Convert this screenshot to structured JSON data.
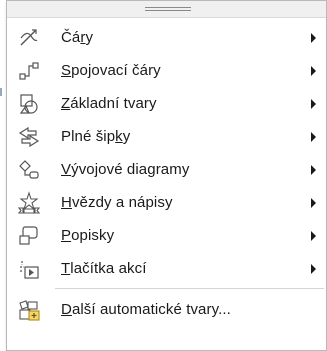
{
  "menu": {
    "items": [
      {
        "pre": "Čá",
        "key": "r",
        "post": "y",
        "icon": "lines-icon",
        "submenu": true
      },
      {
        "pre": "",
        "key": "S",
        "post": "pojovací čáry",
        "icon": "connectors-icon",
        "submenu": true
      },
      {
        "pre": "",
        "key": "Z",
        "post": "ákladní tvary",
        "icon": "basic-shapes-icon",
        "submenu": true
      },
      {
        "pre": "Plné šip",
        "key": "k",
        "post": "y",
        "icon": "block-arrows-icon",
        "submenu": true
      },
      {
        "pre": "",
        "key": "V",
        "post": "ývojové diagramy",
        "icon": "flowchart-icon",
        "submenu": true
      },
      {
        "pre": "",
        "key": "H",
        "post": "vězdy a nápisy",
        "icon": "stars-banners-icon",
        "submenu": true
      },
      {
        "pre": "",
        "key": "P",
        "post": "opisky",
        "icon": "callouts-icon",
        "submenu": true
      },
      {
        "pre": "",
        "key": "T",
        "post": "lačítka akcí",
        "icon": "action-buttons-icon",
        "submenu": true
      },
      {
        "pre": "",
        "key": "D",
        "post": "alší automatické tvary...",
        "icon": "more-autoshapes-icon",
        "submenu": false
      }
    ]
  }
}
